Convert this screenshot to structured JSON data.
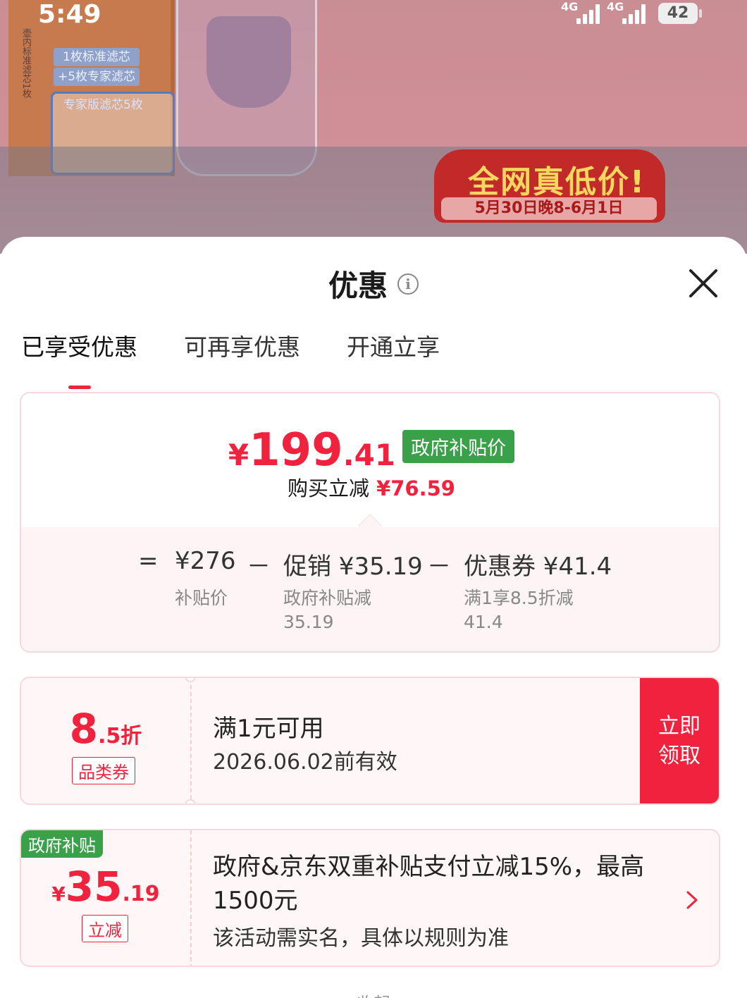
{
  "status_bar": {
    "time": "5:49",
    "signal1": "4G",
    "signal2": "4G",
    "battery": "42"
  },
  "background": {
    "box_tag_1": "1枚标准滤芯",
    "box_tag_2": "+5枚专家滤芯",
    "box_panel_title": "专家版滤芯5枚",
    "box_side_text": "壶内标准滤芯1枚",
    "badge_title": "全网真低价!",
    "badge_sub": "5月30日晚8-6月1日"
  },
  "sheet": {
    "title": "优惠",
    "tabs": [
      {
        "label": "已享受优惠",
        "active": true
      },
      {
        "label": "可再享优惠",
        "active": false
      },
      {
        "label": "开通立享",
        "active": false
      }
    ]
  },
  "summary": {
    "currency": "¥",
    "price_int": "199",
    "price_dec": ".41",
    "price_tag": "政府补贴价",
    "reduce_label": "购买立减",
    "reduce_amount": "¥76.59",
    "breakdown": {
      "eq": "=",
      "base_value": "¥276",
      "base_label": "补贴价",
      "minus1": "－",
      "promo_value": "促销 ¥35.19",
      "promo_label": "政府补贴减",
      "promo_label_value": "35.19",
      "minus2": "－",
      "coupon_value": "优惠券 ¥41.4",
      "coupon_label": "满1享8.5折减",
      "coupon_label_value": "41.4"
    }
  },
  "coupon": {
    "value_int": "8",
    "value_dec": ".5折",
    "type": "品类券",
    "condition": "满1元可用",
    "valid_until": "2026.06.02前有效",
    "button_line1": "立即",
    "button_line2": "领取"
  },
  "subsidy": {
    "tag": "政府补贴",
    "currency": "¥",
    "value_int": "35",
    "value_dec": ".19",
    "type": "立减",
    "title": "政府&京东双重补贴支付立减15%，最高1500元",
    "note": "该活动需实名，具体以规则为准"
  },
  "bottom_peek": "收起",
  "colors": {
    "accent_red": "#f0223d",
    "gov_green": "#3aa04a",
    "card_border": "#f8d8de",
    "card_bg": "#fff6f7"
  }
}
